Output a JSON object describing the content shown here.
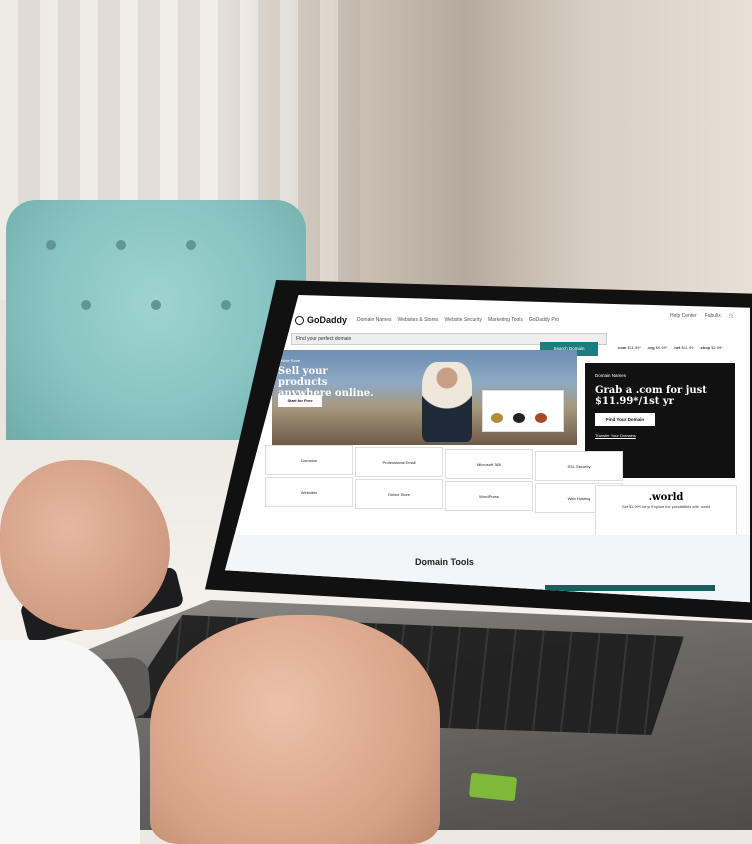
{
  "site": {
    "logo": "GoDaddy",
    "nav": [
      "Domain Names",
      "Websites & Stores",
      "Website Security",
      "Marketing Tools",
      "GoDaddy Pro"
    ],
    "nav_right": {
      "help": "Help Center",
      "account": "Fabulix",
      "cart": "cart"
    }
  },
  "search": {
    "placeholder": "Find your perfect domain",
    "button": "Search Domain"
  },
  "tlds": [
    {
      "name": ".com",
      "price": "$11.99*"
    },
    {
      "name": ".org",
      "price": "$9.99*"
    },
    {
      "name": ".net",
      "price": "$11.99"
    },
    {
      "name": ".shop",
      "price": "$2.99*"
    }
  ],
  "hero": {
    "eyebrow": "Online Store",
    "title": "Sell your products anywhere online.",
    "button": "Start for Free"
  },
  "promo": {
    "label": "Domain Names",
    "title": "Grab a .com for just $11.99*/1st yr",
    "button": "Find Your Domain",
    "link": "Transfer Your Domains"
  },
  "categories": [
    [
      "Domains",
      "Professional Email",
      "Microsoft 365",
      "SSL Security"
    ],
    [
      "Websites",
      "Online Store",
      "WordPress",
      "Web Hosting"
    ]
  ],
  "world": {
    "name": ".world",
    "desc": "Get $1.99*/1st yr Explore the possibilities with .world"
  },
  "tools": {
    "title": "Domain Tools"
  },
  "colors": {
    "teal": "#1b7d80",
    "black": "#111111",
    "chair": "#8cc8c5"
  }
}
